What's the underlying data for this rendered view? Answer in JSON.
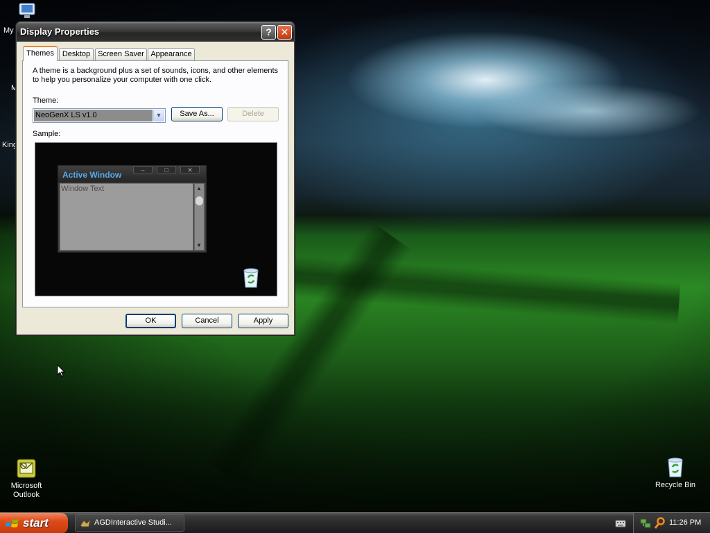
{
  "desktop": {
    "partial_labels": [
      "My",
      "M",
      "King"
    ],
    "icons": [
      {
        "label_line1": "Microsoft",
        "label_line2": "Outlook",
        "icon": "outlook-icon"
      },
      {
        "label": "Recycle Bin",
        "icon": "recycle-bin-icon"
      }
    ]
  },
  "dialog": {
    "title": "Display Properties",
    "help_label": "?",
    "close_label": "✕",
    "tabs": [
      {
        "label": "Themes",
        "active": true
      },
      {
        "label": "Desktop"
      },
      {
        "label": "Screen Saver"
      },
      {
        "label": "Appearance"
      }
    ],
    "description": "A theme is a background plus a set of sounds, icons, and other elements to help you personalize your computer with one click.",
    "theme_label": "Theme:",
    "theme_value": "NeoGenX LS v1.0",
    "save_as_label": "Save As...",
    "delete_label": "Delete",
    "sample_label": "Sample:",
    "sample": {
      "window_title": "Active Window",
      "window_text": "Window Text",
      "min_glyph": "–",
      "max_glyph": "□",
      "close_glyph": "✕"
    },
    "ok_label": "OK",
    "cancel_label": "Cancel",
    "apply_label": "Apply"
  },
  "taskbar": {
    "start_label": "start",
    "tasks": [
      {
        "label": "AGDInteractive Studi...",
        "icon": "agd-app-icon"
      }
    ],
    "clock": "11:26 PM"
  },
  "colors": {
    "dialog_bg": "#ece9d8",
    "start_button": "#dd4a1a",
    "active_tab_accent": "#e68b2c",
    "sample_title": "#5aa8e8"
  }
}
